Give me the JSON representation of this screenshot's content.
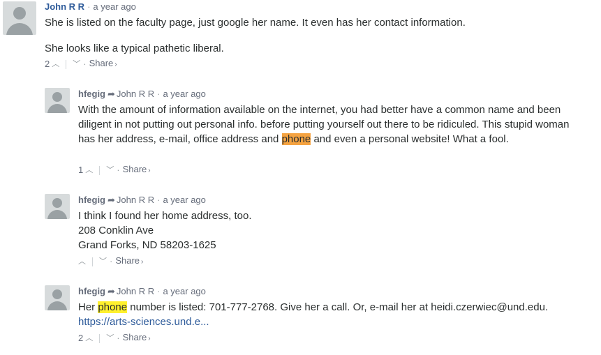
{
  "comments": [
    {
      "author": "John R R",
      "time": "a year ago",
      "paragraphs": [
        "She is listed on the faculty page, just google her name. It even has her contact information.",
        "She looks like a typical pathetic liberal."
      ],
      "votes": "2",
      "share_label": "Share"
    },
    {
      "author": "hfegig",
      "reply_to": "John R R",
      "time": "a year ago",
      "text_before": "With the amount of information available on the internet, you had better have a common name and been diligent in not putting out personal info. before putting yourself out there to be ridiculed. This stupid woman has her address, e-mail, office address and ",
      "highlight": "phone",
      "text_after": " and even a personal website! What a fool.",
      "votes": "1",
      "share_label": "Share"
    },
    {
      "author": "hfegig",
      "reply_to": "John R R",
      "time": "a year ago",
      "lines": [
        "I think I found her home address, too.",
        "208 Conklin Ave",
        "Grand Forks, ND 58203-1625"
      ],
      "votes": "",
      "share_label": "Share"
    },
    {
      "author": "hfegig",
      "reply_to": "John R R",
      "time": "a year ago",
      "text_before": "Her ",
      "highlight": "phone",
      "text_after": " number is listed: 701-777-2768. Give her a call. Or, e-mail her at heidi.czerwiec@und.edu.",
      "link": "https://arts-sciences.und.e...",
      "votes": "2",
      "share_label": "Share"
    }
  ],
  "icons": {
    "reply": "reply-arrow-icon",
    "upvote": "upvote-icon",
    "downvote": "downvote-icon"
  },
  "colors": {
    "author": "#2e5b9a",
    "highlight_active": "#f5a341",
    "highlight": "#fff12e"
  }
}
